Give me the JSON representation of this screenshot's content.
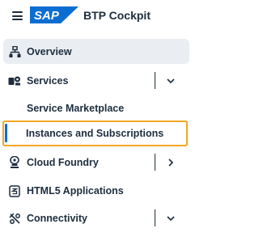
{
  "header": {
    "menu_icon": "hamburger-menu-icon",
    "logo_text": "SAP",
    "title": "BTP Cockpit",
    "colors": {
      "logo_blue": "#0a6ed1",
      "logo_text": "#ffffff"
    }
  },
  "nav": {
    "items": [
      {
        "label": "Overview",
        "icon": "sitemap-icon",
        "state": "selected"
      },
      {
        "label": "Services",
        "icon": "services-icon",
        "expandable": true,
        "expanded": true,
        "children": [
          {
            "label": "Service Marketplace"
          },
          {
            "label": "Instances and Subscriptions",
            "state": "active"
          }
        ]
      },
      {
        "label": "Cloud Foundry",
        "icon": "cloud-foundry-icon",
        "expandable": true,
        "expanded": false
      },
      {
        "label": "HTML5 Applications",
        "icon": "html5-icon"
      },
      {
        "label": "Connectivity",
        "icon": "connectivity-icon",
        "expandable": true,
        "expanded": true
      }
    ]
  },
  "colors": {
    "selected_bg": "#eaeef2",
    "active_border": "#f5a623",
    "active_bar": "#0a6ed1",
    "text": "#1d2d3e"
  }
}
